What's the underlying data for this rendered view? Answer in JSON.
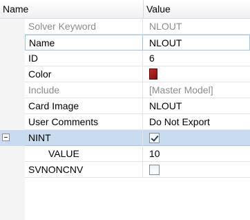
{
  "header": {
    "name": "Name",
    "value": "Value"
  },
  "colors": {
    "selected_row": "#c9dcef",
    "swatch": "#a01818"
  },
  "rows": [
    {
      "name": "Solver Keyword",
      "value": "NLOUT"
    },
    {
      "name": "Name",
      "value": "NLOUT"
    },
    {
      "name": "ID",
      "value": "6"
    },
    {
      "name": "Color",
      "value": "",
      "icon": "color-swatch"
    },
    {
      "name": "Include",
      "value": "[Master Model]"
    },
    {
      "name": "Card Image",
      "value": "NLOUT"
    },
    {
      "name": "User Comments",
      "value": "Do Not Export"
    },
    {
      "name": "NINT",
      "value": "",
      "checked": true,
      "expanded": true
    },
    {
      "name": "VALUE",
      "value": "10"
    },
    {
      "name": "SVNONCNV",
      "value": "",
      "checked": false
    }
  ]
}
